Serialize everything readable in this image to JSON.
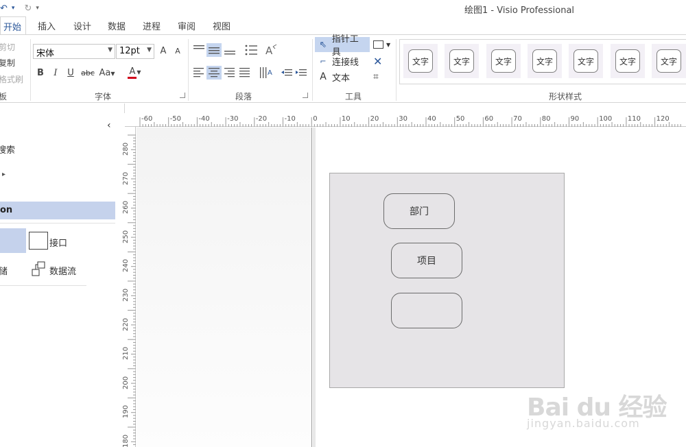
{
  "titlebar": {
    "qat": [
      "↶",
      "▾",
      "↻",
      "▾"
    ],
    "title": "绘图1 - Visio Professional"
  },
  "tabs": [
    "开始",
    "插入",
    "设计",
    "数据",
    "进程",
    "审阅",
    "视图"
  ],
  "ribbon": {
    "clipboard": {
      "cut": "剪切",
      "copy": "复制",
      "format_painter": "格式刷",
      "label": "板"
    },
    "font": {
      "name": "宋体",
      "size": "12pt",
      "grow": "A",
      "shrink": "A",
      "bold": "B",
      "italic": "I",
      "underline": "U",
      "strike": "abc",
      "case": "Aa",
      "color": "A",
      "label": "字体"
    },
    "paragraph": {
      "label": "段落"
    },
    "tools": {
      "pointer": "指针工具",
      "connector": "连接线",
      "text": "文本",
      "label": "工具"
    },
    "shape_styles": {
      "swatch_text": "文字",
      "count": 7,
      "label": "形状样式"
    }
  },
  "leftpane": {
    "collapse": "‹",
    "search": "搜索",
    "expand": "▸",
    "stencil": "on",
    "shape_interface": "接口",
    "shape_storage": "储",
    "shape_dataflow": "数据流"
  },
  "ruler": {
    "h": [
      "-60",
      "-50",
      "-40",
      "-30",
      "-20",
      "-10",
      "0",
      "10",
      "20",
      "30",
      "40",
      "50",
      "60",
      "70",
      "80",
      "90",
      "100",
      "110",
      "120"
    ],
    "v": [
      "280",
      "270",
      "260",
      "250",
      "240",
      "230",
      "220",
      "210",
      "200",
      "190",
      "180"
    ]
  },
  "canvas": {
    "shape1": "部门",
    "shape2": "项目",
    "shape3": ""
  },
  "watermark": {
    "main": "Bai du 经验",
    "sub": "jingyan.baidu.com"
  }
}
